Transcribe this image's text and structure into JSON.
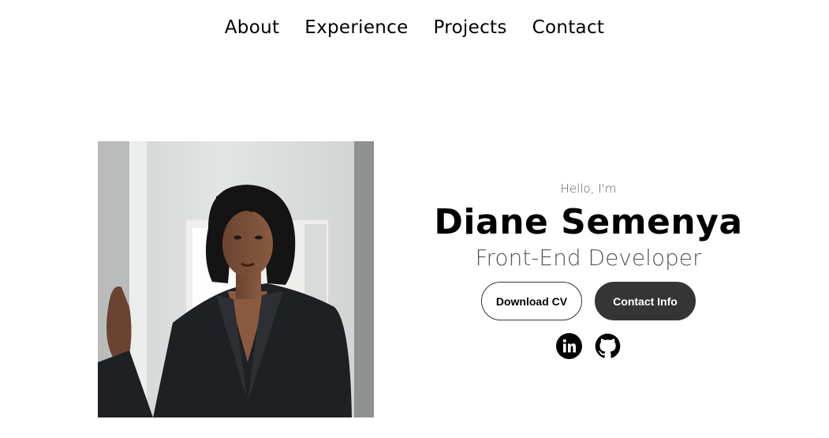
{
  "nav": {
    "items": [
      {
        "label": "About"
      },
      {
        "label": "Experience"
      },
      {
        "label": "Projects"
      },
      {
        "label": "Contact"
      }
    ]
  },
  "hero": {
    "greeting": "Hello, I'm",
    "name": "Diane Semenya",
    "role": "Front-End Developer",
    "buttons": {
      "download_cv": "Download CV",
      "contact_info": "Contact Info"
    },
    "socials": [
      {
        "icon": "linkedin-icon"
      },
      {
        "icon": "github-icon"
      }
    ]
  },
  "colors": {
    "dark": "#353535",
    "text_muted": "#555555"
  }
}
